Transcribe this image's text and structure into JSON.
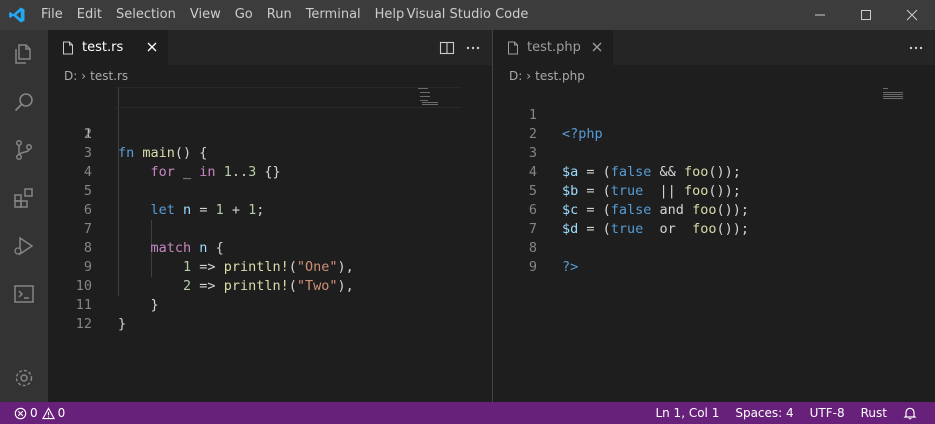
{
  "window": {
    "title": "Visual Studio Code",
    "menu": [
      "File",
      "Edit",
      "Selection",
      "View",
      "Go",
      "Run",
      "Terminal",
      "Help"
    ]
  },
  "left_editor": {
    "tab_label": "test.rs",
    "breadcrumb": [
      "D:",
      "test.rs"
    ],
    "lines": [
      {
        "n": "1"
      },
      {
        "n": "2"
      },
      {
        "n": "3"
      },
      {
        "n": "4"
      },
      {
        "n": "5"
      },
      {
        "n": "6"
      },
      {
        "n": "7"
      },
      {
        "n": "8"
      },
      {
        "n": "9"
      },
      {
        "n": "10"
      },
      {
        "n": "11"
      },
      {
        "n": "12"
      }
    ],
    "tokens": {
      "l1": [
        "fn",
        " ",
        "main",
        "() {"
      ],
      "l3": [
        "    ",
        "for",
        " _ ",
        "in",
        " ",
        "1",
        "..",
        "3",
        " {}"
      ],
      "l5": [
        "    ",
        "let",
        " ",
        "n",
        " = ",
        "1",
        " + ",
        "1",
        ";"
      ],
      "l7": [
        "    ",
        "match",
        " ",
        "n",
        " {"
      ],
      "l8": [
        "        ",
        "1",
        " => ",
        "println!",
        "(",
        "\"One\"",
        "),"
      ],
      "l9": [
        "        ",
        "2",
        " => ",
        "println!",
        "(",
        "\"Two\"",
        "),"
      ],
      "l10": [
        "    }"
      ],
      "l11": [
        "}"
      ]
    }
  },
  "right_editor": {
    "tab_label": "test.php",
    "breadcrumb": [
      "D:",
      "test.php"
    ],
    "lines": [
      {
        "n": "1"
      },
      {
        "n": "2"
      },
      {
        "n": "3"
      },
      {
        "n": "4"
      },
      {
        "n": "5"
      },
      {
        "n": "6"
      },
      {
        "n": "7"
      },
      {
        "n": "8"
      },
      {
        "n": "9"
      }
    ],
    "tokens": {
      "l1": [
        "<?php"
      ],
      "l3": [
        "$a",
        " = (",
        "false",
        " && ",
        "foo",
        "());"
      ],
      "l4": [
        "$b",
        " = (",
        "true",
        "  || ",
        "foo",
        "());"
      ],
      "l5": [
        "$c",
        " = (",
        "false",
        " and ",
        "foo",
        "());"
      ],
      "l6": [
        "$d",
        " = (",
        "true",
        "  or  ",
        "foo",
        "());"
      ],
      "l8": [
        "?>"
      ]
    }
  },
  "statusbar": {
    "errors": "0",
    "warnings": "0",
    "position": "Ln 1, Col 1",
    "spaces": "Spaces: 4",
    "encoding": "UTF-8",
    "language": "Rust"
  },
  "colors": {
    "statusbar": "#68217a",
    "keyword": "#569cd6",
    "control": "#c586c0",
    "function": "#dcdcaa",
    "string": "#ce9178",
    "number": "#b5cea8",
    "variable": "#9cdcfe"
  },
  "icons": {
    "app": "vscode-logo-icon",
    "activity": [
      "explorer-icon",
      "search-icon",
      "source-control-icon",
      "extensions-icon",
      "run-debug-icon",
      "remote-terminal-icon",
      "settings-gear-icon"
    ],
    "editor_actions": [
      "split-editor-icon",
      "more-actions-icon"
    ],
    "status": [
      "error-icon",
      "warning-icon",
      "bell-icon"
    ]
  }
}
